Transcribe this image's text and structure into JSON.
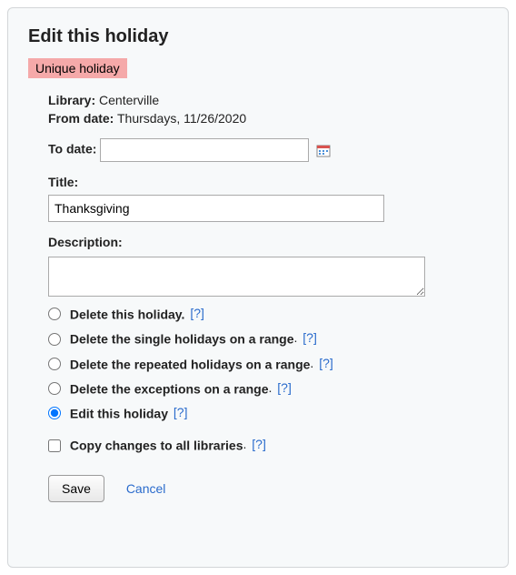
{
  "heading": "Edit this holiday",
  "badge": "Unique holiday",
  "library": {
    "label": "Library:",
    "value": "Centerville"
  },
  "from_date": {
    "label": "From date:",
    "value": "Thursdays, 11/26/2020"
  },
  "to_date": {
    "label": "To date:",
    "value": ""
  },
  "title": {
    "label": "Title:",
    "value": "Thanksgiving"
  },
  "description": {
    "label": "Description:",
    "value": ""
  },
  "options": {
    "delete_holiday": "Delete this holiday.",
    "delete_singles": "Delete the single holidays on a range",
    "delete_repeated": "Delete the repeated holidays on a range",
    "delete_exceptions": "Delete the exceptions on a range",
    "edit": "Edit this holiday"
  },
  "copy": {
    "label": "Copy changes to all libraries"
  },
  "help_text": "[?]",
  "buttons": {
    "save": "Save",
    "cancel": "Cancel"
  }
}
